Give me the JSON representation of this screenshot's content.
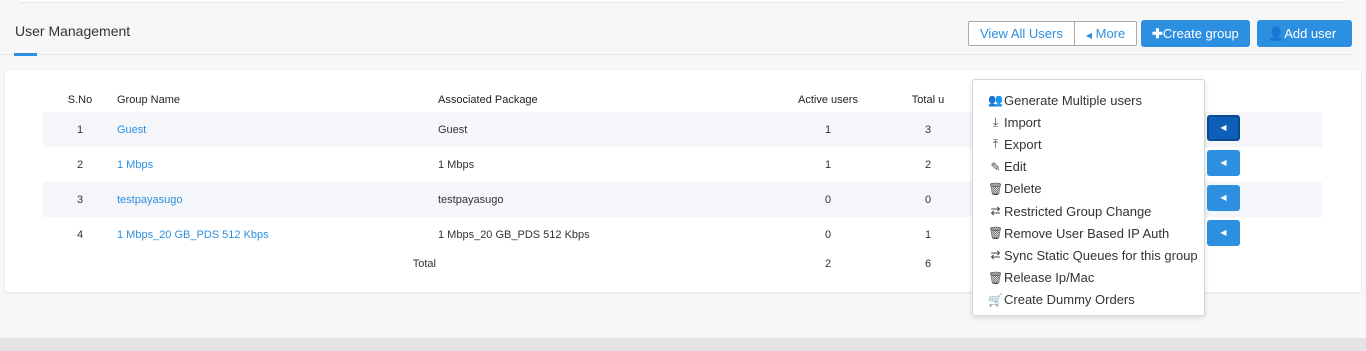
{
  "header": {
    "title": "User Management",
    "view_all_label": "View All Users",
    "more_label": "More",
    "create_group_label": "Create group",
    "add_user_label": "Add user"
  },
  "table": {
    "columns": [
      "S.No",
      "Group Name",
      "Associated Package",
      "Active users",
      "Total u"
    ],
    "rows": [
      {
        "sno": "1",
        "group": "Guest",
        "package": "Guest",
        "active": "1",
        "total": "3"
      },
      {
        "sno": "2",
        "group": "1 Mbps",
        "package": "1 Mbps",
        "active": "1",
        "total": "2"
      },
      {
        "sno": "3",
        "group": "testpayasugo",
        "package": "testpayasugo",
        "active": "0",
        "total": "0"
      },
      {
        "sno": "4",
        "group": "1 Mbps_20 GB_PDS 512 Kbps",
        "package": "1 Mbps_20 GB_PDS 512 Kbps",
        "active": "0",
        "total": "1"
      }
    ],
    "total_row": {
      "label": "Total",
      "active": "2",
      "total": "6"
    }
  },
  "dropdown": {
    "items": [
      {
        "label": "Generate Multiple users",
        "icon": "users-icon"
      },
      {
        "label": "Import",
        "icon": "download-icon"
      },
      {
        "label": "Export",
        "icon": "upload-icon"
      },
      {
        "label": "Edit",
        "icon": "edit-icon"
      },
      {
        "label": "Delete",
        "icon": "trash-icon"
      },
      {
        "label": "Restricted Group Change",
        "icon": "exchange-icon"
      },
      {
        "label": "Remove User Based IP Auth",
        "icon": "trash-icon"
      },
      {
        "label": "Sync Static Queues for this group",
        "icon": "exchange-icon"
      },
      {
        "label": "Release Ip/Mac",
        "icon": "trash-icon"
      },
      {
        "label": "Create Dummy Orders",
        "icon": "cart-icon"
      }
    ]
  },
  "colors": {
    "accent": "#2d8fe0",
    "active_button": "#0d5fb8"
  }
}
